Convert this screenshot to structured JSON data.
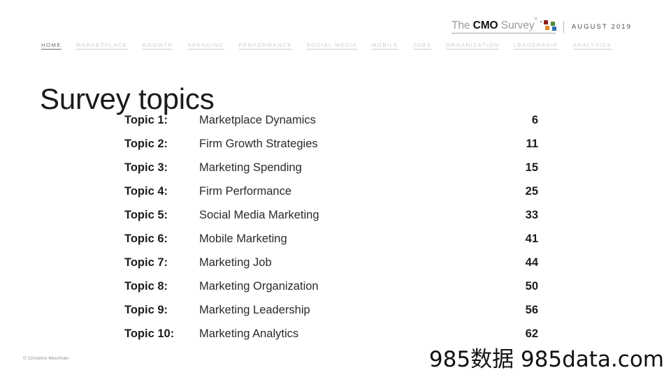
{
  "header": {
    "logo": {
      "the": "The",
      "cmo": "CMO",
      "survey": "Survey",
      "trademark": "®",
      "dots": [
        {
          "name": "logo-dot-gray",
          "color": "#8d8d8d"
        },
        {
          "name": "logo-dot-red",
          "color": "#8f1f1f"
        },
        {
          "name": "logo-dot-green",
          "color": "#4f8a3a"
        },
        {
          "name": "logo-dot-orange",
          "color": "#e08a2e"
        },
        {
          "name": "logo-dot-blue",
          "color": "#2f6fb5"
        }
      ]
    },
    "date": "AUGUST 2019"
  },
  "nav": {
    "items": [
      {
        "label": "HOME",
        "active": true
      },
      {
        "label": "MARKETPLACE",
        "active": false
      },
      {
        "label": "GROWTH",
        "active": false
      },
      {
        "label": "SPENDING",
        "active": false
      },
      {
        "label": "PERFORMANCE",
        "active": false
      },
      {
        "label": "SOCIAL MEDIA",
        "active": false
      },
      {
        "label": "MOBILE",
        "active": false
      },
      {
        "label": "JOBS",
        "active": false
      },
      {
        "label": "ORGANIZATION",
        "active": false
      },
      {
        "label": "LEADERSHIP",
        "active": false
      },
      {
        "label": "ANALYTICS",
        "active": false
      }
    ]
  },
  "title": "Survey topics",
  "topics": [
    {
      "label": "Topic 1:",
      "name": "Marketplace Dynamics",
      "page": "6"
    },
    {
      "label": "Topic 2:",
      "name": "Firm Growth Strategies",
      "page": "11"
    },
    {
      "label": "Topic 3:",
      "name": "Marketing Spending",
      "page": "15"
    },
    {
      "label": "Topic 4:",
      "name": "Firm Performance",
      "page": "25"
    },
    {
      "label": "Topic 5:",
      "name": "Social Media Marketing",
      "page": "33"
    },
    {
      "label": "Topic 6:",
      "name": "Mobile Marketing",
      "page": "41"
    },
    {
      "label": "Topic 7:",
      "name": "Marketing Job",
      "page": "44"
    },
    {
      "label": "Topic 8:",
      "name": "Marketing Organization",
      "page": "50"
    },
    {
      "label": "Topic 9:",
      "name": "Marketing Leadership",
      "page": "56"
    },
    {
      "label": "Topic 10:",
      "name": "Marketing Analytics",
      "page": "62"
    }
  ],
  "footer": {
    "copyright": "© Christine Moorman",
    "watermark": "985数据 985data.com"
  },
  "colors": {
    "text_primary": "#1c1c1c",
    "nav_inactive": "#cccccc",
    "nav_active": "#6e6e6e",
    "logo_gray": "#9b9b9b"
  }
}
